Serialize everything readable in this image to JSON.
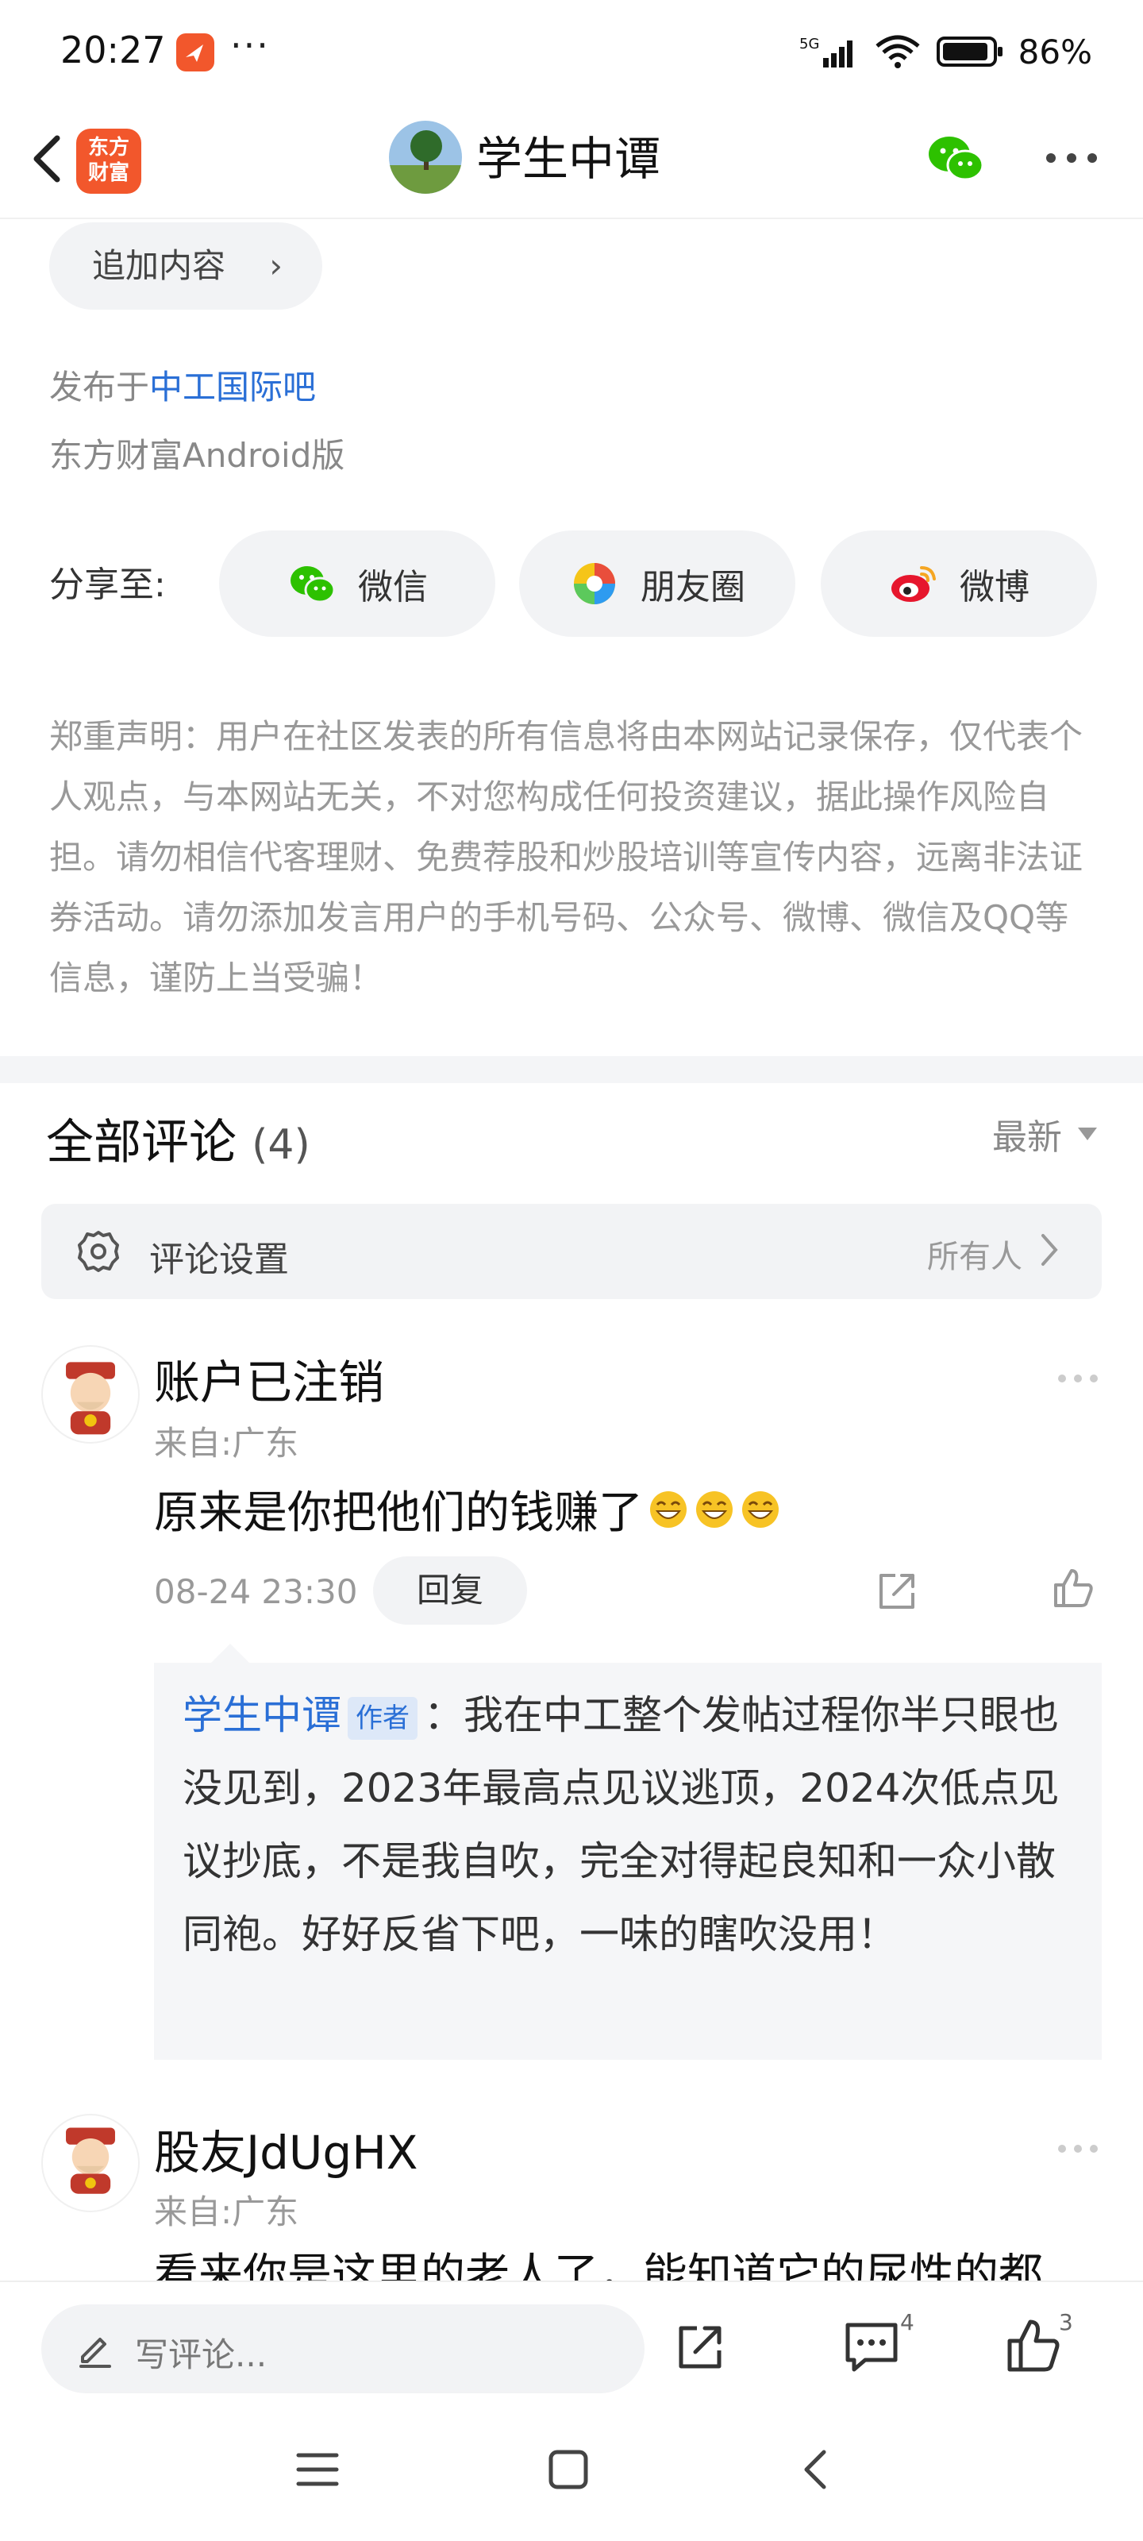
{
  "status_bar": {
    "time": "20:27",
    "dots": "···",
    "network": "5G",
    "battery": "86%"
  },
  "nav": {
    "brand_logo": "东方\n财富",
    "title": "学生中谭"
  },
  "post": {
    "append_label": "追加内容",
    "published_prefix": "发布于",
    "published_forum": "中工国际吧",
    "platform": "东方财富Android版"
  },
  "share": {
    "label": "分享至:",
    "wechat": "微信",
    "moments": "朋友圈",
    "weibo": "微博"
  },
  "disclaimer": "郑重声明：用户在社区发表的所有信息将由本网站记录保存，仅代表个人观点，与本网站无关，不对您构成任何投资建议，据此操作风险自担。请勿相信代客理财、免费荐股和炒股培训等宣传内容，远离非法证券活动。请勿添加发言用户的手机号码、公众号、微博、微信及QQ等信息，谨防上当受骗！",
  "comments_header": {
    "title": "全部评论",
    "count": "(4)",
    "sort": "最新"
  },
  "comment_settings": {
    "label": "评论设置",
    "value": "所有人"
  },
  "comments": [
    {
      "name": "账户已注销",
      "location": "来自:广东",
      "text": "原来是你把他们的钱赚了",
      "time": "08-24 23:30",
      "reply_label": "回复",
      "reply": {
        "author": "学生中谭",
        "badge": "作者",
        "text": "：我在中工整个发帖过程你半只眼也没见到，2023年最高点见议逃顶，2024次低点见议抄底，不是我自吹，完全对得起良知和一众小散同袍。好好反省下吧，一味的瞎吹没用！"
      }
    },
    {
      "name": "股友JdUgHX",
      "location": "来自:广东",
      "text": "看来你是这里的老人了，能知道它的尿性的都"
    }
  ],
  "bottom_bar": {
    "placeholder": "写评论...",
    "comment_count": "4",
    "like_count": "3"
  },
  "colors": {
    "brand": "#f2572c",
    "link": "#2a6fd6",
    "wechat": "#2dc100"
  }
}
